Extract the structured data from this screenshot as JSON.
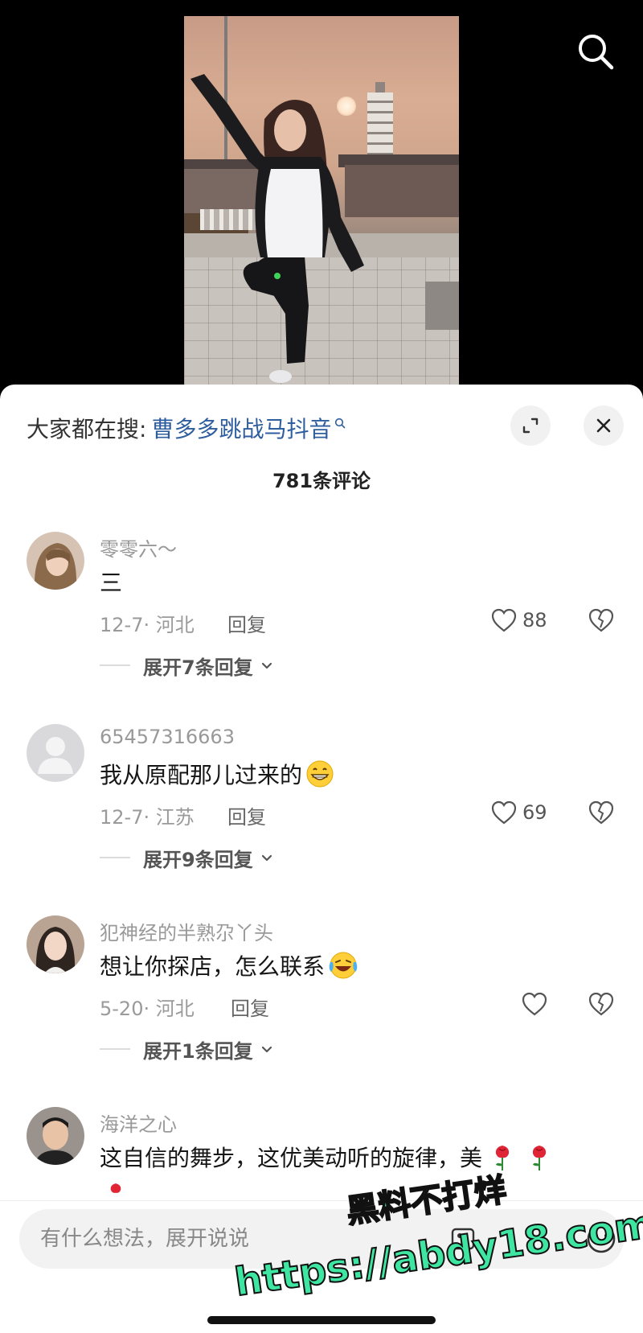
{
  "video": {
    "search_icon": "search-icon"
  },
  "sheet": {
    "search_hint_prefix": "大家都在搜:",
    "search_hint_term": "曹多多跳战马抖音",
    "comment_count": "781条评论"
  },
  "comments": [
    {
      "username": "零零六～",
      "content": "三",
      "date_location": "12-7· 河北",
      "reply_label": "回复",
      "likes": "88",
      "expand_label": "展开7条回复"
    },
    {
      "username": "65457316663",
      "content": "我从原配那儿过来的",
      "emoji": "grinning-face",
      "date_location": "12-7· 江苏",
      "reply_label": "回复",
      "likes": "69",
      "expand_label": "展开9条回复"
    },
    {
      "username": "犯神经的半熟尕丫头",
      "content": "想让你探店，怎么联系",
      "emoji": "laughing-tears-face",
      "date_location": "5-20· 河北",
      "reply_label": "回复",
      "likes": "",
      "expand_label": "展开1条回复"
    },
    {
      "username": "海洋之心",
      "content": "这自信的舞步，这优美动听的旋律，美",
      "emoji": "rose"
    }
  ],
  "input": {
    "placeholder": "有什么想法，展开说说"
  },
  "watermark": {
    "line1": "黑料不打烊",
    "line2": "https://abdy18.com"
  },
  "colors": {
    "link_blue": "#2f5e9f",
    "watermark_green": "#3ee6a2"
  }
}
